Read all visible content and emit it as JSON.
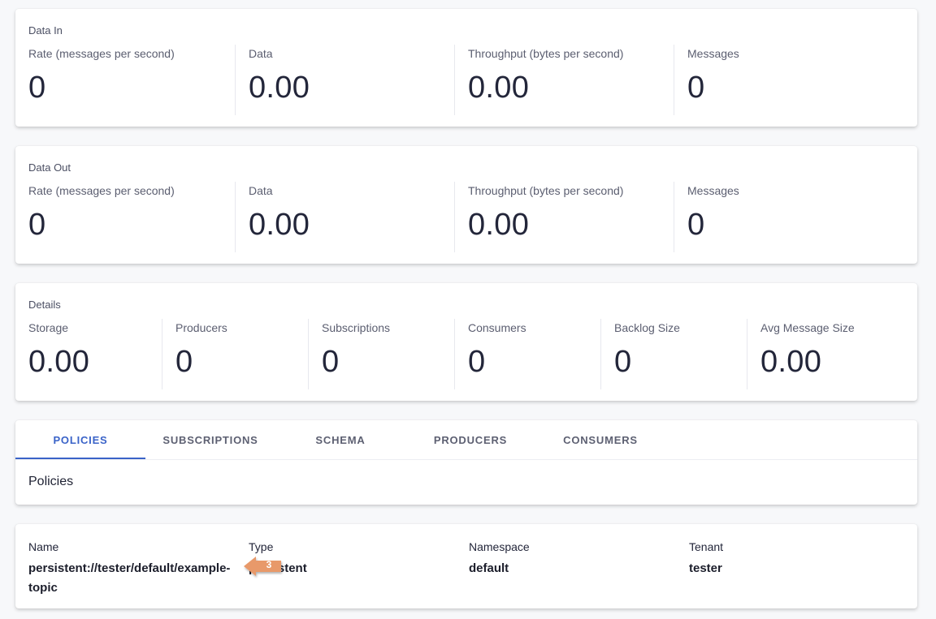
{
  "data_in": {
    "title": "Data In",
    "stats": [
      {
        "label": "Rate (messages per second)",
        "value": "0"
      },
      {
        "label": "Data",
        "value": "0.00"
      },
      {
        "label": "Throughput (bytes per second)",
        "value": "0.00"
      },
      {
        "label": "Messages",
        "value": "0"
      }
    ]
  },
  "data_out": {
    "title": "Data Out",
    "stats": [
      {
        "label": "Rate (messages per second)",
        "value": "0"
      },
      {
        "label": "Data",
        "value": "0.00"
      },
      {
        "label": "Throughput (bytes per second)",
        "value": "0.00"
      },
      {
        "label": "Messages",
        "value": "0"
      }
    ]
  },
  "details": {
    "title": "Details",
    "stats": [
      {
        "label": "Storage",
        "value": "0.00"
      },
      {
        "label": "Producers",
        "value": "0"
      },
      {
        "label": "Subscriptions",
        "value": "0"
      },
      {
        "label": "Consumers",
        "value": "0"
      },
      {
        "label": "Backlog Size",
        "value": "0"
      },
      {
        "label": "Avg Message Size",
        "value": "0.00"
      }
    ]
  },
  "tabs": {
    "items": [
      {
        "label": "POLICIES",
        "active": true
      },
      {
        "label": "SUBSCRIPTIONS",
        "active": false
      },
      {
        "label": "SCHEMA",
        "active": false
      },
      {
        "label": "PRODUCERS",
        "active": false
      },
      {
        "label": "CONSUMERS",
        "active": false
      }
    ],
    "section_heading": "Policies"
  },
  "topic_info": {
    "name_label": "Name",
    "name_value": "persistent://tester/default/example-topic",
    "type_label": "Type",
    "type_value": "persistent",
    "namespace_label": "Namespace",
    "namespace_value": "default",
    "tenant_label": "Tenant",
    "tenant_value": "tester"
  },
  "callout": {
    "number": "3",
    "color": "#e8996b"
  },
  "colors": {
    "accent": "#3a63c8",
    "background": "#f7f8fa"
  }
}
